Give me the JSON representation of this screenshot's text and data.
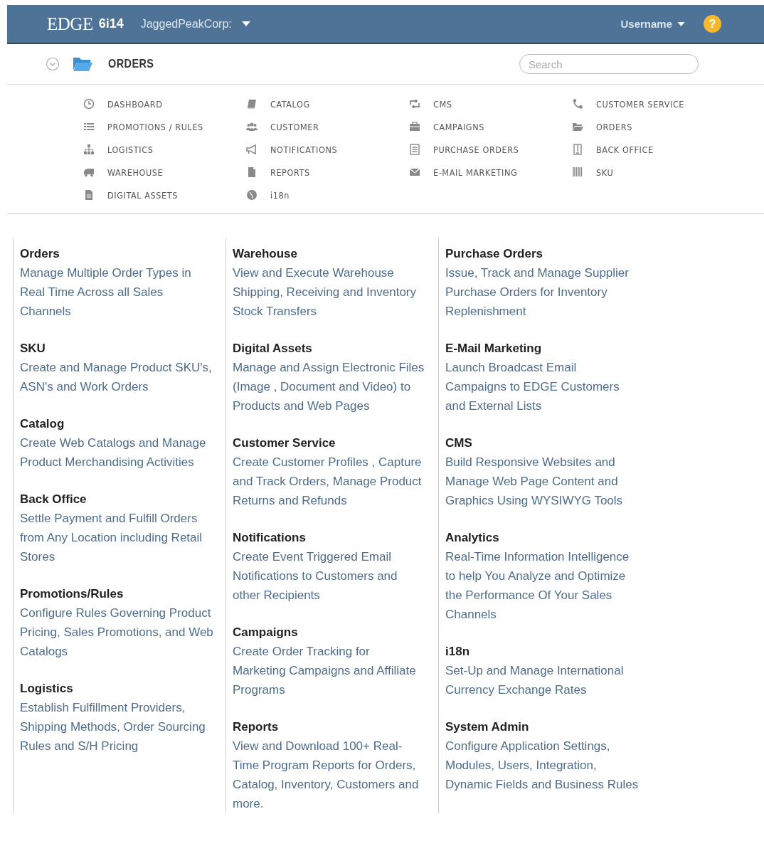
{
  "header": {
    "logo": "EDGE",
    "version": "6i14",
    "company": "JaggedPeakCorp:",
    "user": "Username",
    "help": "?"
  },
  "subheader": {
    "title": "ORDERS",
    "search": {
      "placeholder": "Search"
    }
  },
  "menu": [
    [
      "DASHBOARD",
      "PROMOTIONS / RULES",
      "LOGISTICS",
      "WAREHOUSE",
      "DIGITAL ASSETS"
    ],
    [
      "CATALOG",
      "CUSTOMER",
      "NOTIFICATIONS",
      "REPORTS",
      "i18n"
    ],
    [
      "CMS",
      "CAMPAIGNS",
      "PURCHASE ORDERS",
      "E-MAIL MARKETING"
    ],
    [
      "CUSTOMER SERVICE",
      "ORDERS",
      "BACK OFFICE",
      "SKU"
    ]
  ],
  "modules": [
    [
      {
        "title": "Orders",
        "text": "Manage Multiple Order Types in Real Time Across all Sales Channels"
      },
      {
        "title": "SKU",
        "text": "Create and Manage Product SKU's, ASN's and Work Orders"
      },
      {
        "title": "Catalog",
        "text": "Create Web Catalogs and Manage Product Merchandising Activities"
      },
      {
        "title": "Back Office",
        "text": "Settle Payment and Fulfill Orders from Any Location including Retail Stores"
      },
      {
        "title": "Promotions/Rules",
        "text": "Configure Rules Governing Product Pricing, Sales Promotions, and Web Catalogs"
      },
      {
        "title": "Logistics",
        "text": "Establish Fulfillment Providers, Shipping Methods, Order Sourcing Rules and S/H Pricing"
      }
    ],
    [
      {
        "title": "Warehouse",
        "text": "View and Execute Warehouse Shipping, Receiving and Inventory Stock Transfers"
      },
      {
        "title": "Digital Assets",
        "text": "Manage and Assign Electronic Files (Image , Document and Video) to Products and Web Pages"
      },
      {
        "title": "Customer Service",
        "text": "Create Customer Profiles , Capture and Track Orders, Manage Product Returns and Refunds"
      },
      {
        "title": "Notifications",
        "text": "Create Event Triggered Email Notifications to Customers and other Recipients"
      },
      {
        "title": "Campaigns",
        "text": "Create Order Tracking for Marketing Campaigns and Affiliate Programs"
      },
      {
        "title": "Reports",
        "text": "View and Download 100+ Real-Time Program Reports for Orders, Catalog, Inventory, Customers and more."
      }
    ],
    [
      {
        "title": "Purchase Orders",
        "text": "Issue, Track and Manage Supplier Purchase Orders for Inventory Replenishment"
      },
      {
        "title": "E-Mail Marketing",
        "text": "Launch Broadcast Email Campaigns to EDGE Customers and External Lists"
      },
      {
        "title": "CMS",
        "text": "Build Responsive Websites and Manage Web Page Content and Graphics Using WYSIWYG Tools"
      },
      {
        "title": "Analytics",
        "text": "Real-Time Information Intelligence to help You Analyze and Optimize the Performance Of Your Sales Channels"
      },
      {
        "title": "i18n",
        "text": "Set-Up and Manage International Currency Exchange Rates"
      },
      {
        "title": "System Admin",
        "text": "Configure Application Settings, Modules, Users, Integration, Dynamic Fields and Business Rules"
      }
    ]
  ]
}
